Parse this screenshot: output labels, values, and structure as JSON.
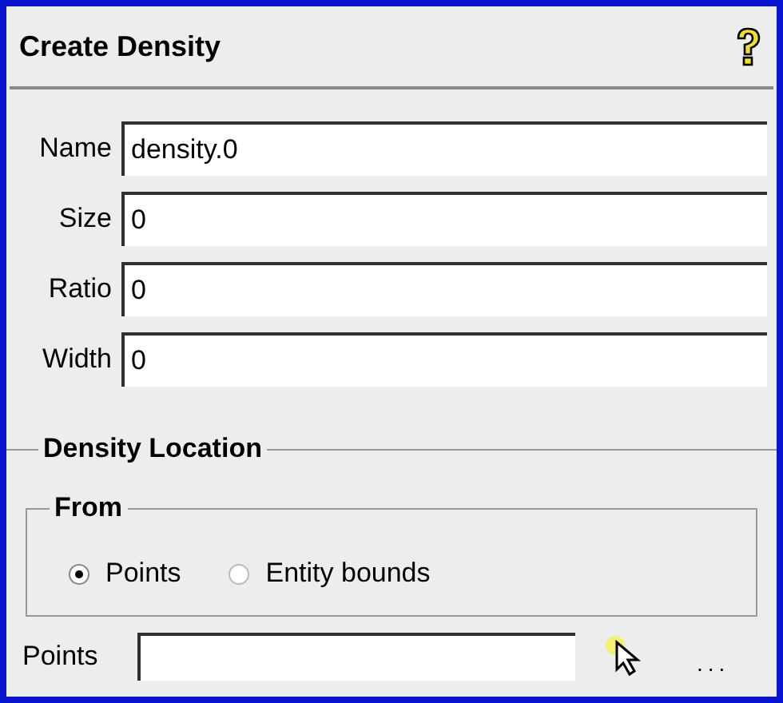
{
  "panel": {
    "title": "Create Density"
  },
  "fields": [
    {
      "label": "Name",
      "value": "density.0"
    },
    {
      "label": "Size",
      "value": "0"
    },
    {
      "label": "Ratio",
      "value": "0"
    },
    {
      "label": "Width",
      "value": "0"
    }
  ],
  "density_location": {
    "title": "Density Location",
    "from": {
      "title": "From",
      "options": [
        {
          "label": "Points",
          "selected": true
        },
        {
          "label": "Entity bounds",
          "selected": false
        }
      ]
    },
    "points": {
      "label": "Points",
      "more": "..."
    }
  }
}
